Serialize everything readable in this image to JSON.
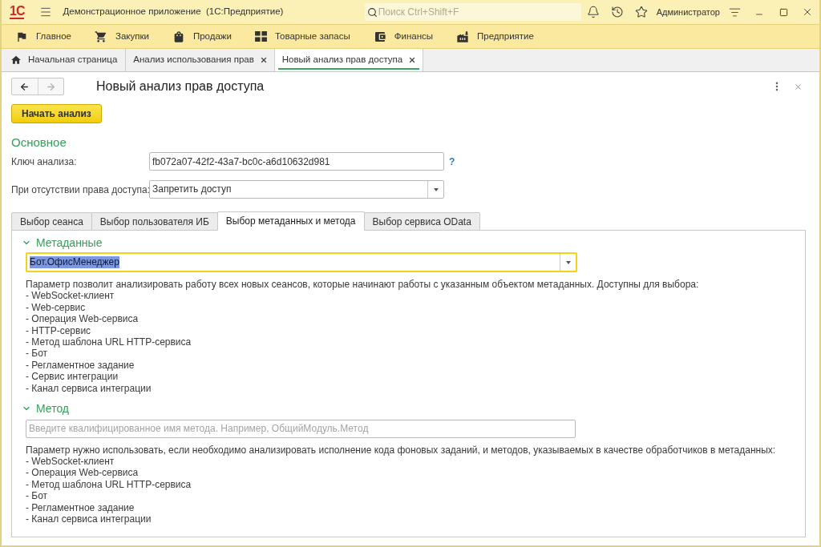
{
  "window": {
    "logo": "1С",
    "title": "Демонстрационное приложение  (1С:Предприятие)",
    "search": {
      "placeholder": "Поиск Ctrl+Shift+F"
    },
    "user": "Администратор"
  },
  "sections": [
    {
      "label": "Главное"
    },
    {
      "label": "Закупки"
    },
    {
      "label": "Продажи"
    },
    {
      "label": "Товарные запасы"
    },
    {
      "label": "Финансы"
    },
    {
      "label": "Предприятие"
    }
  ],
  "open_tabs": [
    {
      "label": "Начальная страница",
      "kind": "home",
      "selected": false
    },
    {
      "label": "Анализ использования прав",
      "kind": "form",
      "selected": false
    },
    {
      "label": "Новый анализ прав доступа",
      "kind": "form",
      "selected": true
    }
  ],
  "form": {
    "nav": {
      "back": {
        "disabled": false
      },
      "forward": {
        "disabled": true
      }
    },
    "title": "Новый анализ прав доступа",
    "start_button": "Начать анализ",
    "group_title": "Основное",
    "fields": [
      {
        "label": "Ключ анализа:",
        "kind": "text",
        "value": "fb072a07-42f2-43a7-bc0c-a6d10632d981",
        "help": "?"
      },
      {
        "label": "При отсутствии права доступа:",
        "kind": "select",
        "value": "Запретить доступ"
      }
    ],
    "tabs": [
      {
        "label": "Выбор сеанса",
        "selected": false
      },
      {
        "label": "Выбор пользователя ИБ",
        "selected": false
      },
      {
        "label": "Выбор метаданных и метода",
        "selected": true
      },
      {
        "label": "Выбор сервиса OData",
        "selected": false
      }
    ],
    "groups": [
      {
        "title": "Метаданные",
        "expanded": true,
        "field": {
          "kind": "select",
          "value": "Бот.ОфисМенеджер",
          "focused": true
        },
        "description": "Параметр позволит анализировать работу всех новых сеансов, которые начинают работы с указанным объектом метаданных. Доступны для выбора:",
        "options": [
          "- WebSocket-клиент",
          "- Web-сервис",
          "- Операция Web-сервиса",
          "- HTTP-сервис",
          "- Метод шаблона URL HTTP-сервиса",
          "- Бот",
          "- Регламентное задание",
          "- Сервис интеграции",
          "- Канал сервиса интеграции"
        ]
      },
      {
        "title": "Метод",
        "expanded": true,
        "field": {
          "kind": "text",
          "placeholder": "Введите квалифицированное имя метода. Например, ОбщийМодуль.Метод",
          "focused": false
        },
        "description": "Параметр нужно использовать, если необходимо анализировать исполнение кода фоновых заданий, и методов, указываемых в качестве обработчиков в метаданных:",
        "options": [
          "- WebSocket-клиент",
          "- Операция Web-сервиса",
          "- Метод шаблона URL HTTP-сервиса",
          "- Бот",
          "- Регламентное задание",
          "- Канал сервиса интеграции"
        ]
      }
    ]
  }
}
